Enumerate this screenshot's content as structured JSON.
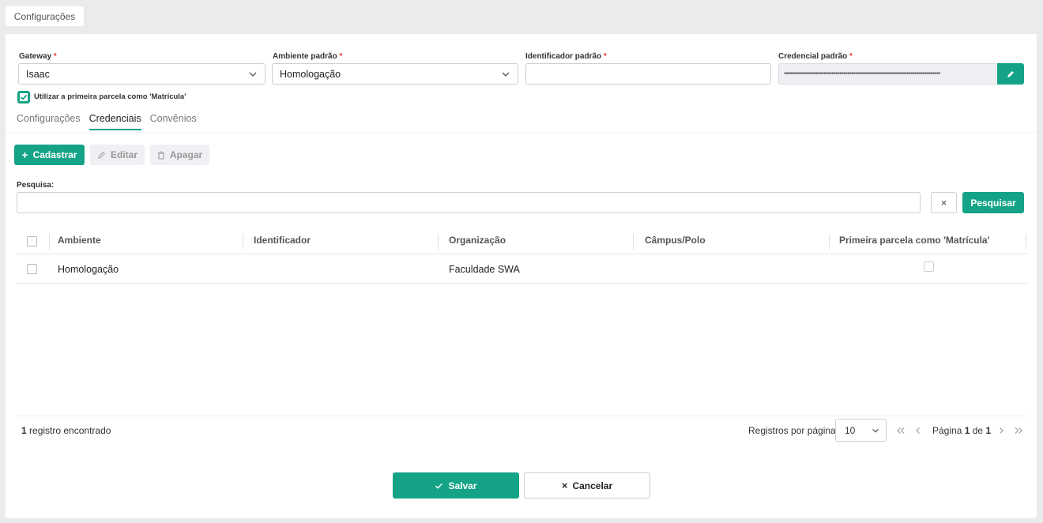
{
  "top_tab": {
    "label": "Configurações"
  },
  "form": {
    "gateway": {
      "label": "Gateway",
      "required_mark": "*",
      "value": "Isaac"
    },
    "ambiente": {
      "label": "Ambiente padrão",
      "required_mark": "*",
      "value": "Homologação"
    },
    "identificador": {
      "label": "Identificador padrão",
      "required_mark": "*",
      "value": ""
    },
    "credencial": {
      "label": "Credencial padrão",
      "required_mark": "*",
      "value": "•••••••••••••••••••••••••••••••••••••••••••••••••••••••••••••••••••••••••••••••"
    },
    "primeira_parcela": {
      "label": "Utilizar a primeira parcela como 'Matrícula'",
      "checked": true
    }
  },
  "tabs": [
    {
      "label": "Configurações",
      "active": false
    },
    {
      "label": "Credenciais",
      "active": true
    },
    {
      "label": "Convênios",
      "active": false
    }
  ],
  "toolbar": {
    "add_label": "Cadastrar",
    "edit_label": "Editar",
    "delete_label": "Apagar"
  },
  "search": {
    "label": "Pesquisa:",
    "value": "",
    "clear_label": "×",
    "submit_label": "Pesquisar"
  },
  "table": {
    "columns": [
      "Ambiente",
      "Identificador",
      "Organização",
      "Câmpus/Polo",
      "Primeira parcela como 'Matrícula'"
    ],
    "rows": [
      {
        "ambiente": "Homologação",
        "identificador": "",
        "organizacao": "Faculdade SWA",
        "campus": "",
        "primeira_parcela": false
      }
    ]
  },
  "pagination": {
    "count": "1",
    "count_suffix": "registro encontrado",
    "per_page_label": "Registros por página:",
    "per_page_value": "10",
    "page_prefix": "Página",
    "page_current": "1",
    "page_of": "de",
    "page_total": "1"
  },
  "actions": {
    "save_label": "Salvar",
    "cancel_label": "Cancelar"
  },
  "colors": {
    "accent": "#14a386",
    "required": "#e53935"
  }
}
